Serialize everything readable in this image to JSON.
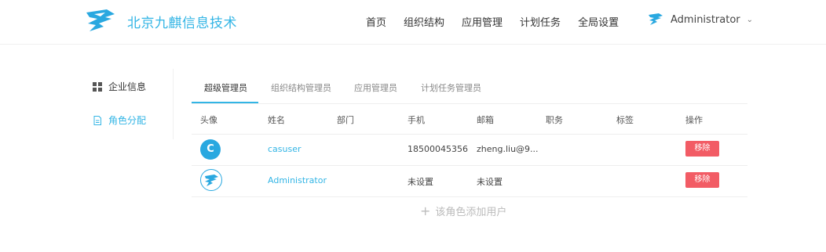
{
  "header": {
    "brand": "北京九麒信息技术",
    "nav": [
      "首页",
      "组织结构",
      "应用管理",
      "计划任务",
      "全局设置"
    ],
    "user_name": "Administrator"
  },
  "sidebar": {
    "items": [
      {
        "label": "企业信息",
        "icon": "grid-icon"
      },
      {
        "label": "角色分配",
        "icon": "document-icon"
      }
    ]
  },
  "tabs": [
    "超级管理员",
    "组织结构管理员",
    "应用管理员",
    "计划任务管理员"
  ],
  "table": {
    "headers": [
      "头像",
      "姓名",
      "部门",
      "手机",
      "邮箱",
      "职务",
      "标签",
      "操作"
    ],
    "rows": [
      {
        "avatar_letter": "C",
        "name": "casuser",
        "dept": "",
        "phone": "18500045356",
        "email": "zheng.liu@9...",
        "job": "",
        "tag": "",
        "action": "移除"
      },
      {
        "avatar_letter": "",
        "name": "Administrator",
        "dept": "",
        "phone": "未设置",
        "email": "未设置",
        "job": "",
        "tag": "",
        "action": "移除"
      }
    ]
  },
  "add_user_label": "该角色添加用户",
  "colors": {
    "accent": "#33b5e5",
    "danger": "#f25c65"
  }
}
